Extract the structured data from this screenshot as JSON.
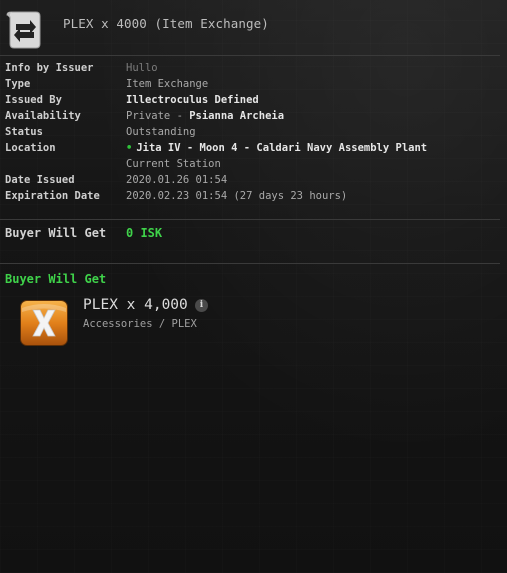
{
  "header": {
    "title": "PLEX x 4000 (Item Exchange)",
    "icon": "contract-exchange-icon"
  },
  "details": [
    {
      "label": "Info by Issuer",
      "value": "Hullo",
      "style": "dim"
    },
    {
      "label": "Type",
      "value": "Item Exchange",
      "style": "normal"
    },
    {
      "label": "Issued By",
      "value": "Illectroculus Defined",
      "style": "bold"
    },
    {
      "label": "Availability",
      "value_prefix": "Private - ",
      "value": "Psianna Archeia",
      "style": "bold"
    },
    {
      "label": "Status",
      "value": "Outstanding",
      "style": "normal"
    },
    {
      "label": "Location",
      "value": "Jita IV - Moon 4 - Caldari Navy Assembly Plant",
      "style": "bold",
      "bullet": "•"
    },
    {
      "label": "",
      "value": "Current Station",
      "style": "normal"
    },
    {
      "label": "Date Issued",
      "value": "2020.01.26 01:54",
      "style": "normal"
    },
    {
      "label": "Expiration Date",
      "value": "2020.02.23 01:54 (27 days 23 hours)",
      "style": "normal"
    }
  ],
  "price": {
    "label": "Buyer Will Get",
    "value": "0 ISK"
  },
  "items_section": {
    "title": "Buyer Will Get",
    "items": [
      {
        "name": "PLEX x 4,000",
        "info_icon": "i",
        "category": "Accessories / PLEX",
        "icon": "plex-icon"
      }
    ]
  },
  "colors": {
    "accent_green": "#3fd24a",
    "plex_orange": "#e98a1c"
  }
}
